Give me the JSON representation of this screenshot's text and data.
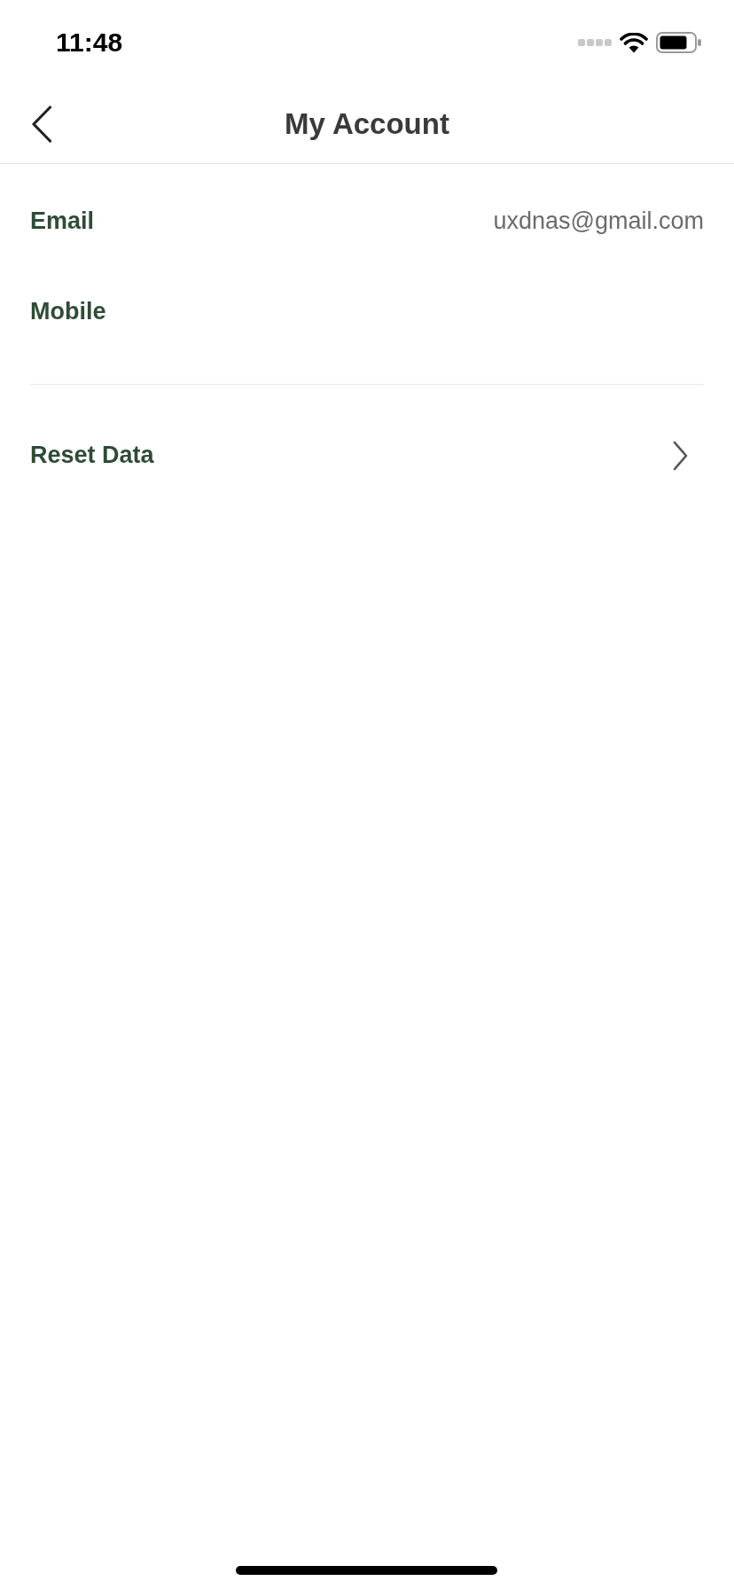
{
  "status_bar": {
    "time": "11:48"
  },
  "header": {
    "title": "My Account"
  },
  "rows": [
    {
      "kind": "info",
      "label": "Email",
      "value": "uxdnas@gmail.com"
    },
    {
      "kind": "info",
      "label": "Mobile"
    },
    {
      "kind": "link",
      "label": "Reset Data"
    }
  ]
}
